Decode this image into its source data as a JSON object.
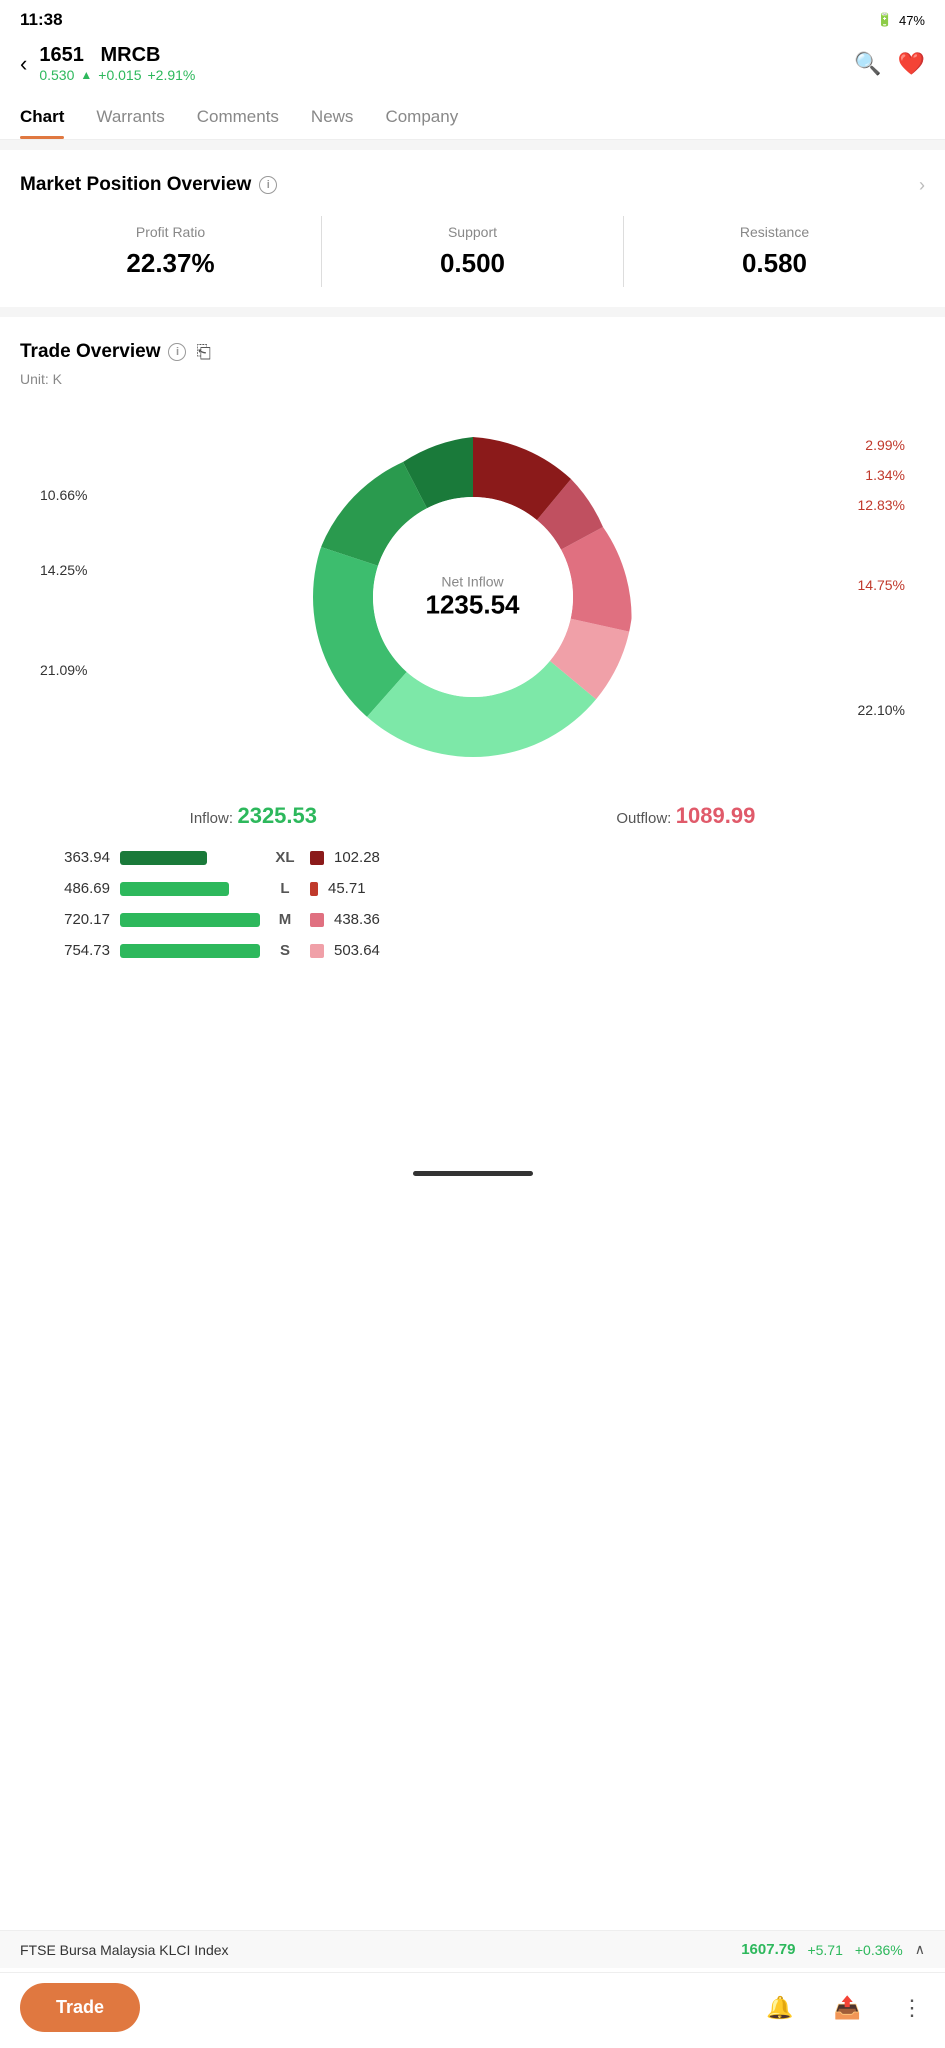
{
  "statusBar": {
    "time": "11:38",
    "battery": "47%"
  },
  "header": {
    "stockCode": "1651",
    "stockName": "MRCB",
    "price": "0.530",
    "arrow": "▲",
    "change": "+0.015",
    "changePct": "+2.91%"
  },
  "tabs": [
    {
      "label": "Chart",
      "active": true
    },
    {
      "label": "Warrants",
      "active": false
    },
    {
      "label": "Comments",
      "active": false
    },
    {
      "label": "News",
      "active": false
    },
    {
      "label": "Company",
      "active": false
    }
  ],
  "marketOverview": {
    "title": "Market Position Overview",
    "profitRatioLabel": "Profit Ratio",
    "profitRatioValue": "22.37%",
    "supportLabel": "Support",
    "supportValue": "0.500",
    "resistanceLabel": "Resistance",
    "resistanceValue": "0.580"
  },
  "tradeOverview": {
    "title": "Trade Overview",
    "unitLabel": "Unit: K",
    "netInflowLabel": "Net Inflow",
    "netInflowValue": "1235.54",
    "inflowLabel": "Inflow:",
    "inflowValue": "2325.53",
    "outflowLabel": "Outflow:",
    "outflowValue": "1089.99",
    "segments": [
      {
        "label": "10.66%",
        "color": "#2a7a4f",
        "side": "left"
      },
      {
        "label": "14.25%",
        "color": "#3dbd6e",
        "side": "left"
      },
      {
        "label": "21.09%",
        "color": "#5dd88f",
        "side": "left"
      },
      {
        "label": "22.10%",
        "color": "#8aeab8",
        "side": "bottom-right"
      },
      {
        "label": "14.75%",
        "color": "#f0a0a8",
        "side": "right"
      },
      {
        "label": "12.83%",
        "color": "#e07080",
        "side": "top-right"
      },
      {
        "label": "1.34%",
        "color": "#d05060",
        "side": "top-right"
      },
      {
        "label": "2.99%",
        "color": "#c03050",
        "side": "top-right"
      }
    ],
    "rows": [
      {
        "inValue": "363.94",
        "category": "XL",
        "inColor": "dark-green",
        "inWidth": "90%",
        "outColor": "dark-red",
        "outDot": "#8b1a1a",
        "outValue": "102.28"
      },
      {
        "inValue": "486.69",
        "category": "L",
        "inColor": "green",
        "inWidth": "70%",
        "outColor": "dark-red-small",
        "outDot": "#c0392b",
        "outValue": "45.71"
      },
      {
        "inValue": "720.17",
        "category": "M",
        "inColor": "green",
        "inWidth": "100%",
        "outColor": "medium-red",
        "outDot": "#e07080",
        "outValue": "438.36"
      },
      {
        "inValue": "754.73",
        "category": "S",
        "inColor": "green",
        "inWidth": "100%",
        "outColor": "light-red",
        "outDot": "#f0a0a8",
        "outValue": "503.64"
      }
    ]
  },
  "bottomIndex": {
    "name": "FTSE Bursa Malaysia KLCI Index",
    "price": "1607.79",
    "change": "+5.71",
    "changePct": "+0.36%"
  },
  "bottomNav": {
    "tradeLabel": "Trade"
  }
}
